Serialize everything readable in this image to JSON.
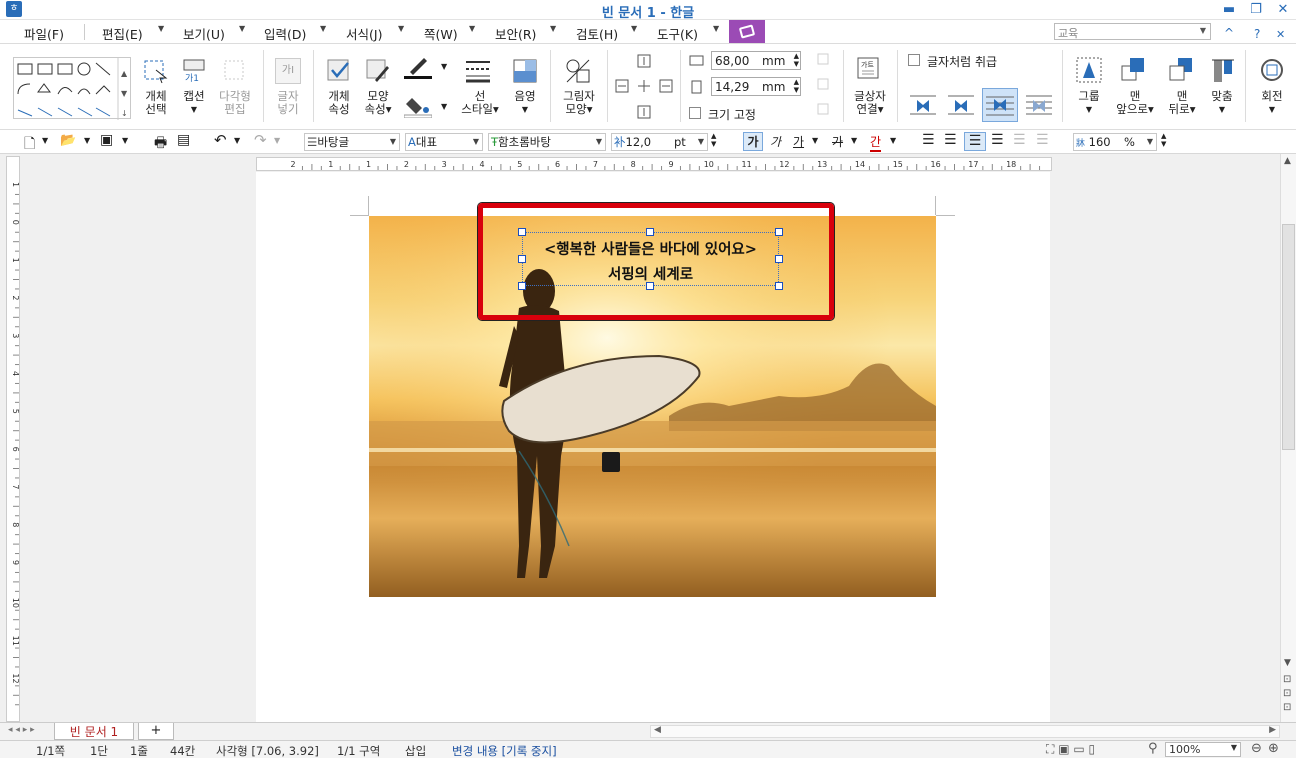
{
  "window": {
    "title": "빈 문서 1 - 한글",
    "minimize": "▬",
    "restore": "❐",
    "close": "✕"
  },
  "menu": {
    "items": [
      "파일(F)",
      "편집(E)",
      "보기(U)",
      "입력(D)",
      "서식(J)",
      "쪽(W)",
      "보안(R)",
      "검토(H)",
      "도구(K)"
    ],
    "search_placeholder": "교육",
    "collapse_arrow": "^",
    "help": "?"
  },
  "ribbon": {
    "object_select": [
      "개체",
      "선택"
    ],
    "caption": [
      "캡션"
    ],
    "polygon_edit": [
      "다각형",
      "편집"
    ],
    "insert_char": [
      "글자",
      "넣기"
    ],
    "obj_props": [
      "개체",
      "속성"
    ],
    "shape_props": [
      "모양",
      "속성▾"
    ],
    "line_style": [
      "선",
      "스타일▾"
    ],
    "shade": [
      "음영"
    ],
    "picture_shape": [
      "그림자",
      "모양▾"
    ],
    "width_value": "68,00",
    "height_value": "14,29",
    "unit": "mm",
    "fix_size": "크기 고정",
    "textbox_link": [
      "글상자",
      "연결▾"
    ],
    "treat_as_char": "글자처럼 취급",
    "group": [
      "그룹"
    ],
    "bring_front": [
      "맨",
      "앞으로▾"
    ],
    "send_back": [
      "맨",
      "뒤로▾"
    ],
    "align": [
      "맞춤"
    ],
    "rotate": [
      "회전"
    ]
  },
  "format": {
    "style": "바탕글",
    "lang": "대표",
    "font": "함초롬바탕",
    "size": "12,0",
    "size_unit": "pt",
    "bold": "가",
    "italic": "가",
    "underline": "가",
    "strike": "가",
    "color": "간",
    "zoom_line": "160",
    "zoom_unit": "%"
  },
  "ruler": {
    "h_ticks": [
      "2",
      "1",
      "1",
      "2",
      "3",
      "4",
      "5",
      "6",
      "7",
      "8",
      "9",
      "10",
      "11",
      "12",
      "13",
      "14",
      "15",
      "16",
      "17",
      "18"
    ],
    "v_ticks": [
      "1",
      "0",
      "1",
      "2",
      "3",
      "4",
      "5",
      "6",
      "7",
      "8",
      "9",
      "10",
      "11",
      "12"
    ]
  },
  "document": {
    "textbox_line1": "<행복한 사람들은 바다에 있어요>",
    "textbox_line2": "서핑의 세계로"
  },
  "tabs": {
    "doc_tab": "빈 문서 1",
    "add": "+"
  },
  "status": {
    "page": "1/1쪽",
    "column": "1단",
    "line": "1줄",
    "char": "44칸",
    "object": "사각형 [7.06, 3.92]",
    "section": "1/1 구역",
    "mode": "삽입",
    "track": "변경 내용 [기록 중지]",
    "zoom": "100%"
  },
  "colors": {
    "accent": "#2a6db8",
    "red_frame": "#d8000c",
    "handle": "#1a4fbf",
    "ribbon_purple": "#9b4bb5"
  }
}
